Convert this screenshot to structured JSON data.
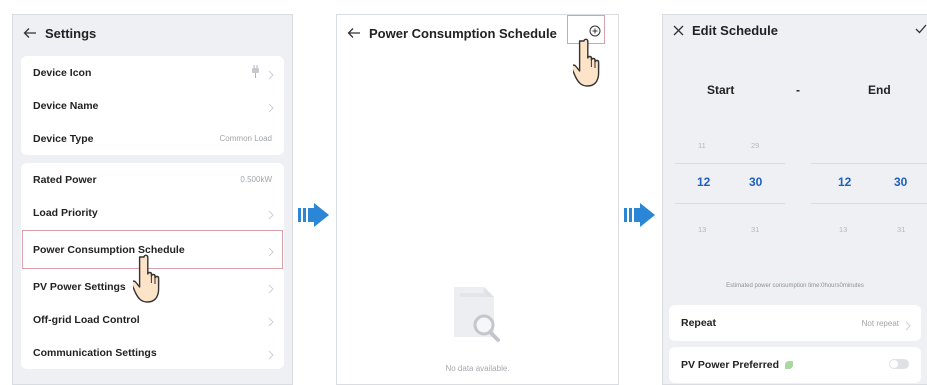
{
  "settings": {
    "title": "Settings",
    "group1": [
      {
        "label": "Device Icon",
        "value": ""
      },
      {
        "label": "Device Name",
        "value": ""
      },
      {
        "label": "Device Type",
        "value": "Common Load"
      }
    ],
    "group2": [
      {
        "label": "Rated Power",
        "value": "0.500kW"
      },
      {
        "label": "Load Priority",
        "value": ""
      },
      {
        "label": "Power Consumption Schedule",
        "value": ""
      },
      {
        "label": "PV Power Settings",
        "value": ""
      },
      {
        "label": "Off-grid Load Control",
        "value": ""
      },
      {
        "label": "Communication Settings",
        "value": ""
      }
    ]
  },
  "schedule": {
    "title": "Power Consumption Schedule",
    "empty_text": "No data available."
  },
  "edit": {
    "title": "Edit Schedule",
    "start_label": "Start",
    "dash": "-",
    "end_label": "End",
    "start_picker": {
      "hour_prev": "11",
      "min_prev": "29",
      "hour": "12",
      "min": "30",
      "hour_next": "13",
      "min_next": "31"
    },
    "end_picker": {
      "hour_prev": "11",
      "min_prev": "",
      "hour": "12",
      "min": "30",
      "hour_next": "13",
      "min_next": "31"
    },
    "estimate_text": "Estimated power consumption time:0hours0minutes",
    "repeat_label": "Repeat",
    "repeat_value": "Not repeat",
    "pv_label": "PV Power Preferred",
    "pv_enabled": false
  },
  "colors": {
    "accent": "#1f5fbf",
    "flow_arrow": "#2b86d6",
    "highlight_border": "#d9a2ab",
    "panel_bg": "#eef0f3"
  },
  "icons": {
    "back": "back-arrow-icon",
    "chevron": "chevron-right-icon",
    "device": "plug-icon",
    "add": "add-circle-icon",
    "pointer": "hand-pointer-icon",
    "flow": "flow-arrow-icon",
    "empty": "empty-document-icon",
    "close": "close-icon",
    "confirm": "check-icon",
    "leaf": "leaf-icon"
  }
}
